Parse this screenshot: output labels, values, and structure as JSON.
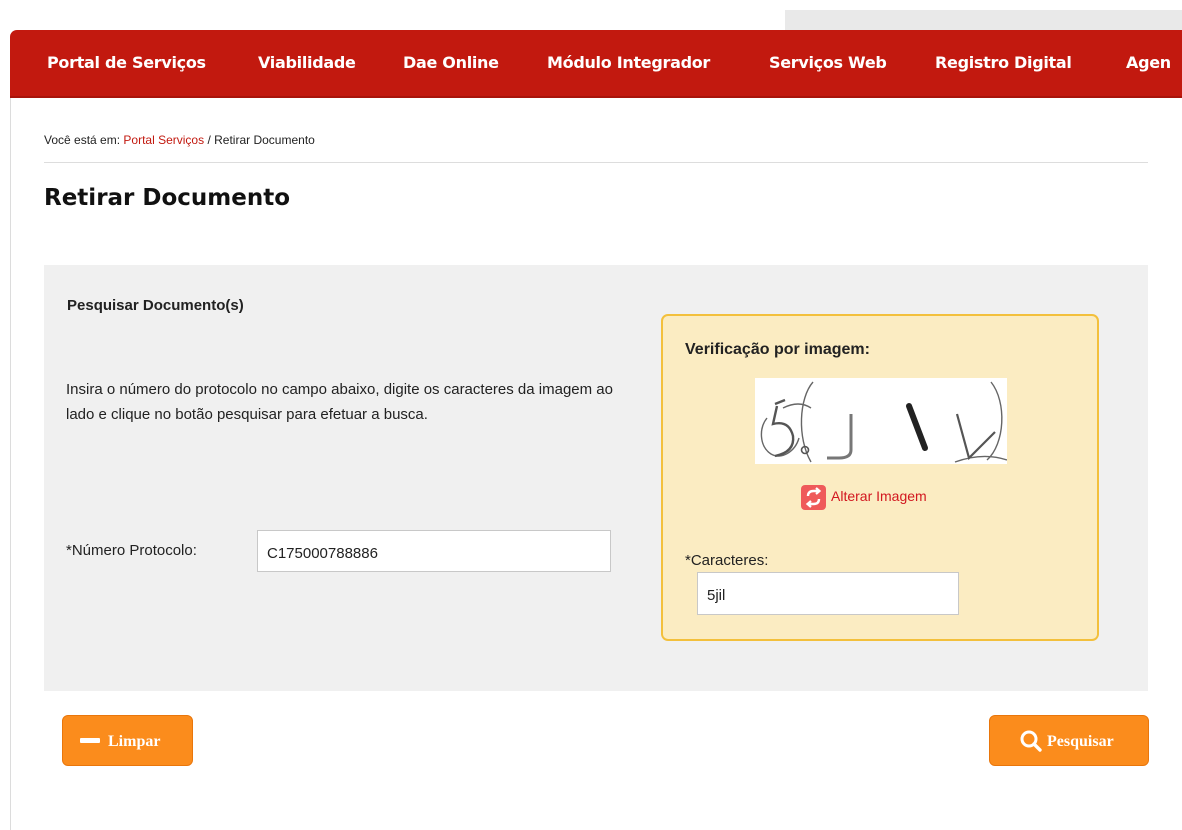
{
  "nav": {
    "items": [
      {
        "label": "Portal de Serviços"
      },
      {
        "label": "Viabilidade"
      },
      {
        "label": "Dae Online"
      },
      {
        "label": "Módulo Integrador"
      },
      {
        "label": "Serviços Web"
      },
      {
        "label": "Registro Digital"
      },
      {
        "label": "Agen"
      }
    ]
  },
  "breadcrumb": {
    "prefix": "Você está em:",
    "link": "Portal Serviços",
    "separator": "/",
    "current": "Retirar Documento"
  },
  "page": {
    "title": "Retirar Documento"
  },
  "search": {
    "title": "Pesquisar Documento(s)",
    "instructions": "Insira o número do protocolo no campo abaixo, digite os caracteres da imagem ao lado e clique no botão pesquisar para efetuar a busca.",
    "protocol_label": "*Número Protocolo:",
    "protocol_value": "C175000788886"
  },
  "captcha": {
    "title": "Verificação por imagem:",
    "refresh_label": "Alterar Imagem",
    "refresh_icon": "refresh-icon",
    "chars_label": "*Caracteres:",
    "chars_value": "5jil"
  },
  "buttons": {
    "clear_label": "Limpar",
    "clear_icon": "minus-icon",
    "search_label": "Pesquisar",
    "search_icon": "search-icon"
  },
  "colors": {
    "nav_bg": "#c2190f",
    "link": "#c2190f",
    "panel_bg": "#f0f0f0",
    "captcha_bg": "#fbecc2",
    "captcha_border": "#f3c03c",
    "button": "#fb8c1c"
  }
}
